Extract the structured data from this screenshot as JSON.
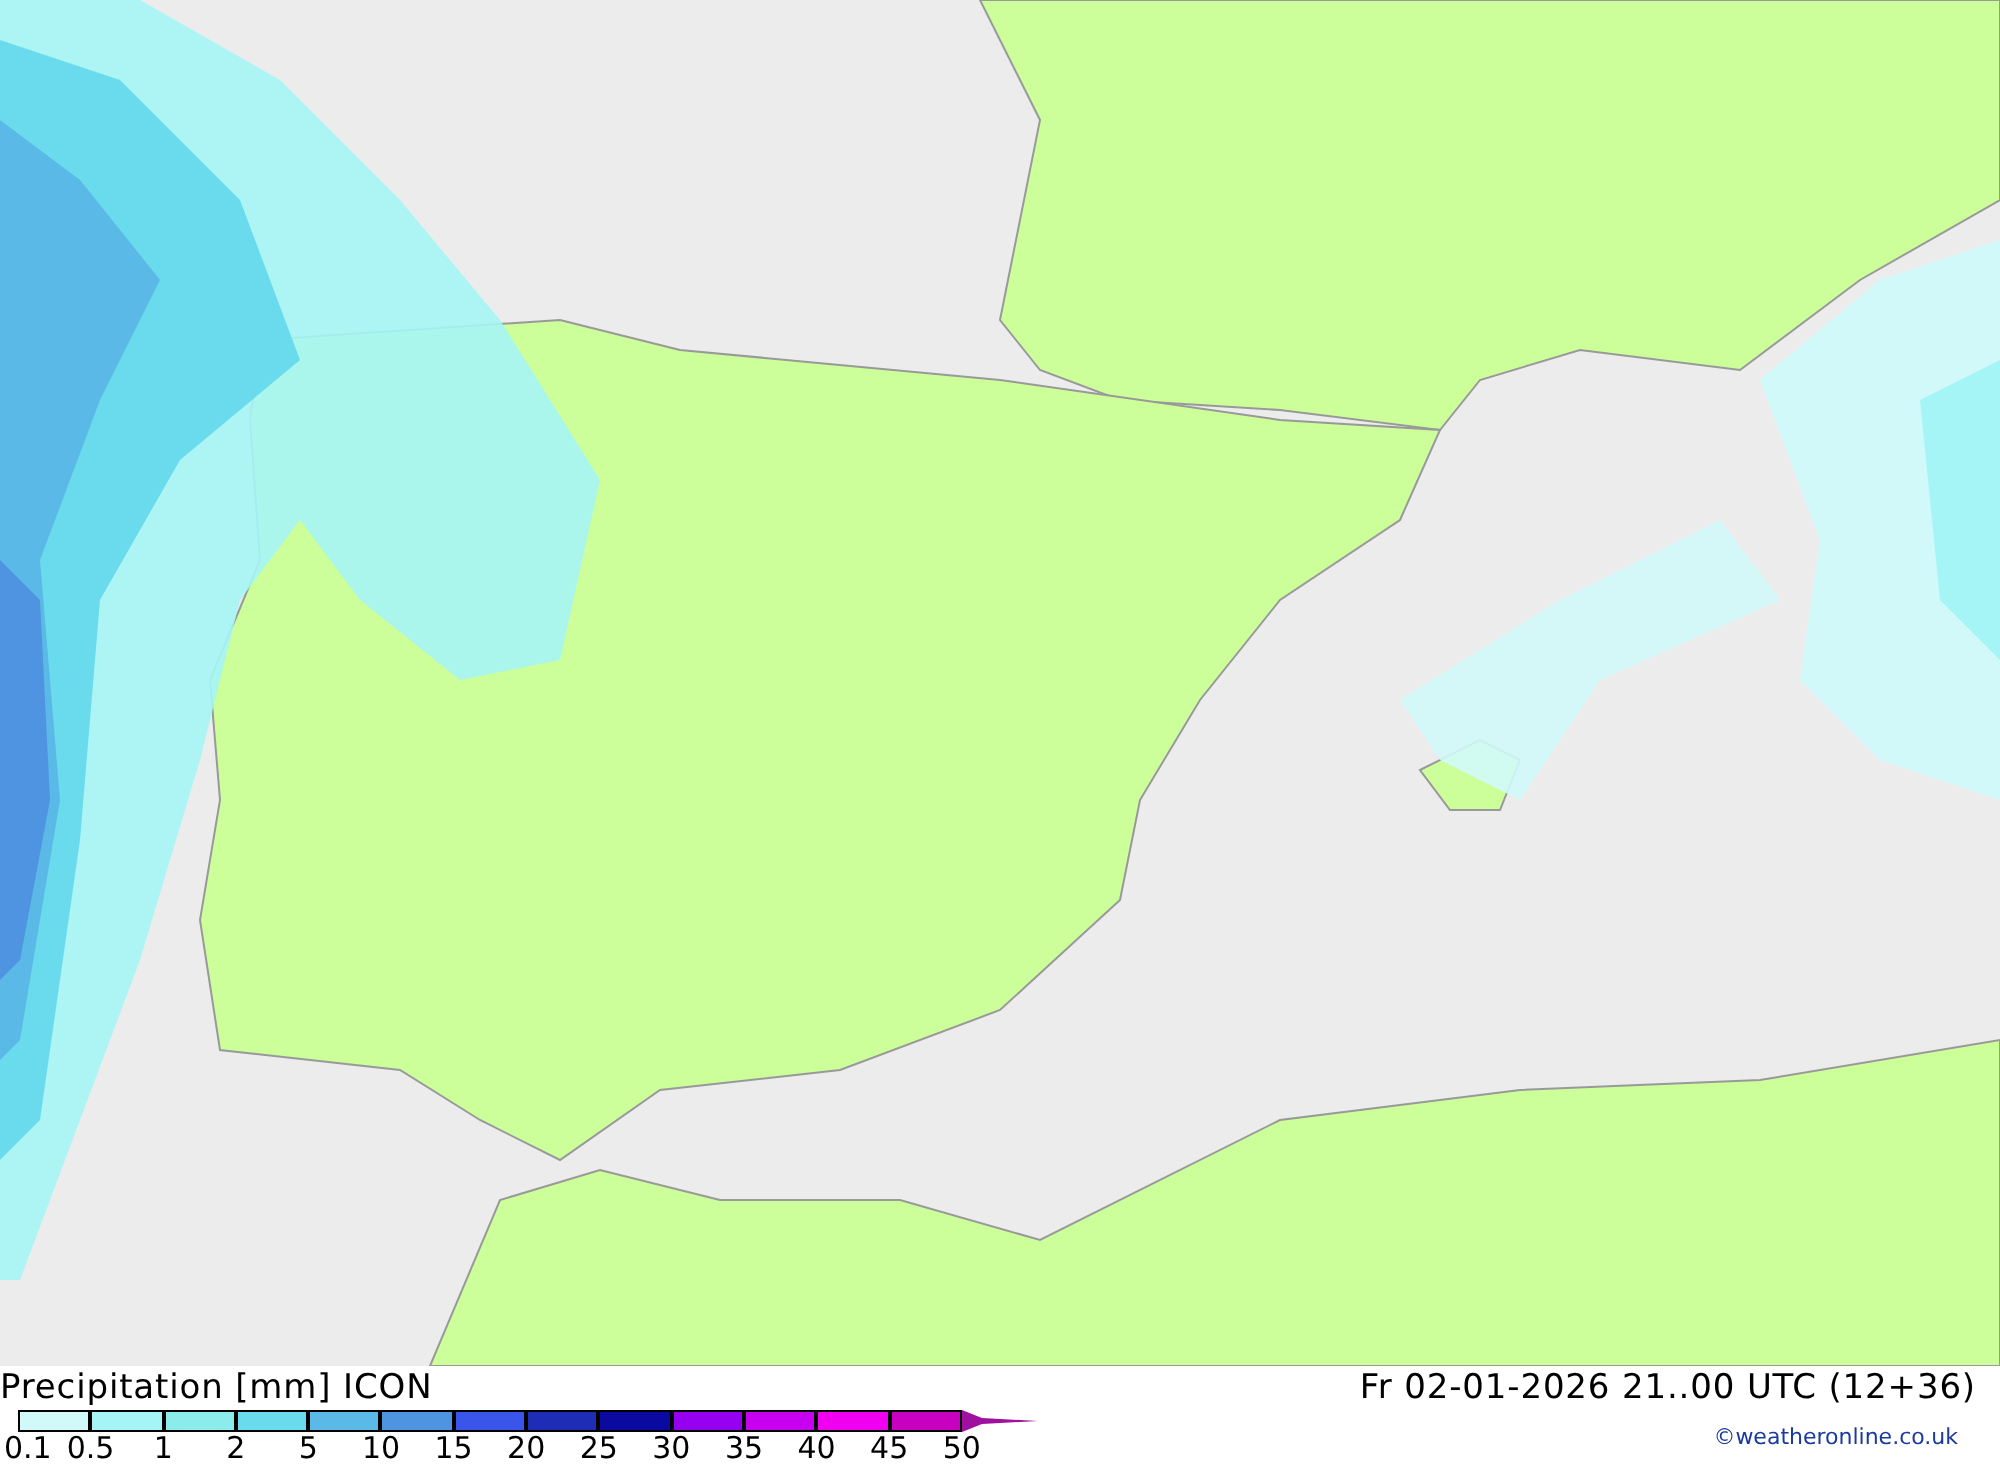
{
  "legend": {
    "title": "Precipitation [mm] ICON",
    "swatches": [
      {
        "color": "#d2f9f9"
      },
      {
        "color": "#a6f5f6"
      },
      {
        "color": "#8cecec"
      },
      {
        "color": "#6adbec"
      },
      {
        "color": "#5ab9e6"
      },
      {
        "color": "#4e94e1"
      },
      {
        "color": "#3a56ea"
      },
      {
        "color": "#1e2db5"
      },
      {
        "color": "#0a0aa0"
      },
      {
        "color": "#9600f0"
      },
      {
        "color": "#c800f0"
      },
      {
        "color": "#f000f0"
      },
      {
        "color": "#c800c0"
      },
      {
        "kind": "arrow",
        "color": "#a0109e"
      }
    ],
    "labels": [
      "0.1",
      "0.5",
      "1",
      "2",
      "5",
      "10",
      "15",
      "20",
      "25",
      "30",
      "35",
      "40",
      "45",
      "50"
    ]
  },
  "valid_time": "Fr 02-01-2026 21..00 UTC (12+36)",
  "credit": "©weatheronline.co.uk"
}
